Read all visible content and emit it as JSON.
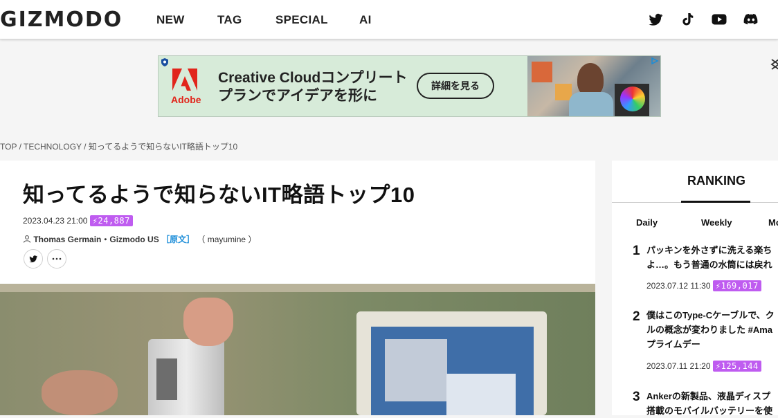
{
  "header": {
    "logo": "GIZMODO",
    "nav": [
      "NEW",
      "TAG",
      "SPECIAL",
      "AI"
    ],
    "social_icons": [
      "twitter-icon",
      "tiktok-icon",
      "youtube-icon",
      "discord-icon"
    ]
  },
  "ad": {
    "headline_line1": "Creative Cloudコンプリート",
    "headline_line2": "プランでアイデアを形に",
    "brand": "Adobe",
    "cta": "詳細を見る"
  },
  "breadcrumb": "TOP / TECHNOLOGY / 知ってるようで知らないIT略語トップ10",
  "article": {
    "title": "知ってるようで知らないIT略語トップ10",
    "date": "2023.04.23 21:00",
    "views": "⚡24,887",
    "author": "Thomas Germain・Gizmodo US",
    "original_link": "［原文］",
    "translator": "（ mayumine ）"
  },
  "sidebar": {
    "title": "RANKING",
    "tabs": [
      "Daily",
      "Weekly",
      "Mo"
    ],
    "items": [
      {
        "rank": "1",
        "line1": "パッキンを外さずに洗える楽ち",
        "line2": "よ…。もう普通の水筒には戻れ",
        "line3": "",
        "date": "2023.07.12 11:30",
        "views": "⚡169,017"
      },
      {
        "rank": "2",
        "line1": "僕はこのType-Cケーブルで、ク",
        "line2": "ルの概念が変わりました #Ama",
        "line3": "プライムデー",
        "date": "2023.07.11 21:20",
        "views": "⚡125,144"
      },
      {
        "rank": "3",
        "line1": "Ankerの新製品、液晶ディスプ",
        "line2": "搭載のモバイルバッテリーを使",
        "line3": "",
        "date": "",
        "views": ""
      }
    ]
  },
  "colors": {
    "accent": "#bf5cf0",
    "link": "#1a8cd8",
    "ad_bg": "#d7ebd9",
    "adobe_red": "#e1251b"
  }
}
